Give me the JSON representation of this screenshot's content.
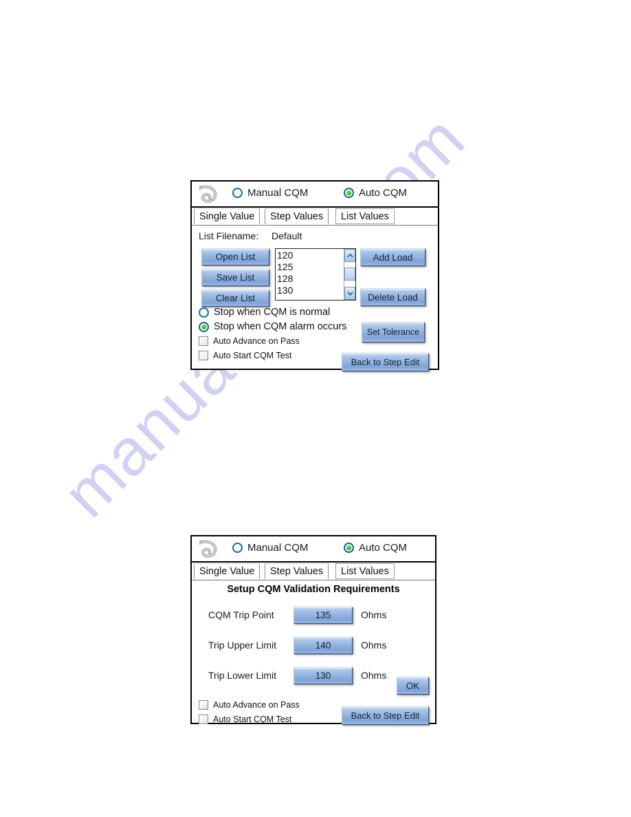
{
  "watermark": {
    "text": "manualshive.com"
  },
  "panel_list": {
    "header": {
      "back_icon": "back-arrow-icon",
      "options": [
        {
          "label": "Manual CQM",
          "selected": false
        },
        {
          "label": "Auto CQM",
          "selected": true
        }
      ]
    },
    "tabs": [
      {
        "label": "Single Value",
        "selected": false
      },
      {
        "label": "Step Values",
        "selected": false
      },
      {
        "label": "List Values",
        "selected": true
      }
    ],
    "filename_label": "List Filename:",
    "filename_value": "Default",
    "left_buttons": [
      {
        "label": "Open List"
      },
      {
        "label": "Save List"
      },
      {
        "label": "Clear List"
      }
    ],
    "listbox": {
      "items": [
        "120",
        "125",
        "128",
        "130"
      ],
      "scroll_up_icon": "chevron-up-icon",
      "scroll_down_icon": "chevron-down-icon"
    },
    "right_buttons": [
      {
        "label": "Add Load"
      },
      {
        "label": "Delete Load"
      },
      {
        "label": "Set Tolerance"
      },
      {
        "label": "Back to Step Edit"
      }
    ],
    "options": [
      {
        "label": "Stop when CQM is normal",
        "type": "radio",
        "selected": false
      },
      {
        "label": "Stop when CQM alarm occurs",
        "type": "radio",
        "selected": true
      },
      {
        "label": "Auto Advance on Pass",
        "type": "checkbox",
        "checked": false
      },
      {
        "label": "Auto Start CQM Test",
        "type": "checkbox",
        "checked": false
      }
    ]
  },
  "panel_setup": {
    "header": {
      "back_icon": "back-arrow-icon",
      "options": [
        {
          "label": "Manual CQM",
          "selected": false
        },
        {
          "label": "Auto CQM",
          "selected": true
        }
      ]
    },
    "tabs": [
      {
        "label": "Single Value",
        "selected": false
      },
      {
        "label": "Step Values",
        "selected": false
      },
      {
        "label": "List Values",
        "selected": true
      }
    ],
    "title": "Setup CQM Validation Requirements",
    "fields": [
      {
        "label": "CQM Trip Point",
        "value": "135",
        "unit": "Ohms"
      },
      {
        "label": "Trip Upper Limit",
        "value": "140",
        "unit": "Ohms"
      },
      {
        "label": "Trip Lower Limit",
        "value": "130",
        "unit": "Ohms"
      }
    ],
    "ok_label": "OK",
    "back_label": "Back to Step Edit",
    "options": [
      {
        "label": "Auto Advance on Pass",
        "type": "checkbox",
        "checked": false
      },
      {
        "label": "Auto Start CQM Test",
        "type": "checkbox",
        "checked": false
      }
    ]
  },
  "colors": {
    "button_blue": "#8fb0dd",
    "radio_green": "#31b824",
    "radio_border": "#1d6d8f",
    "watermark": "#c9c9ef"
  }
}
